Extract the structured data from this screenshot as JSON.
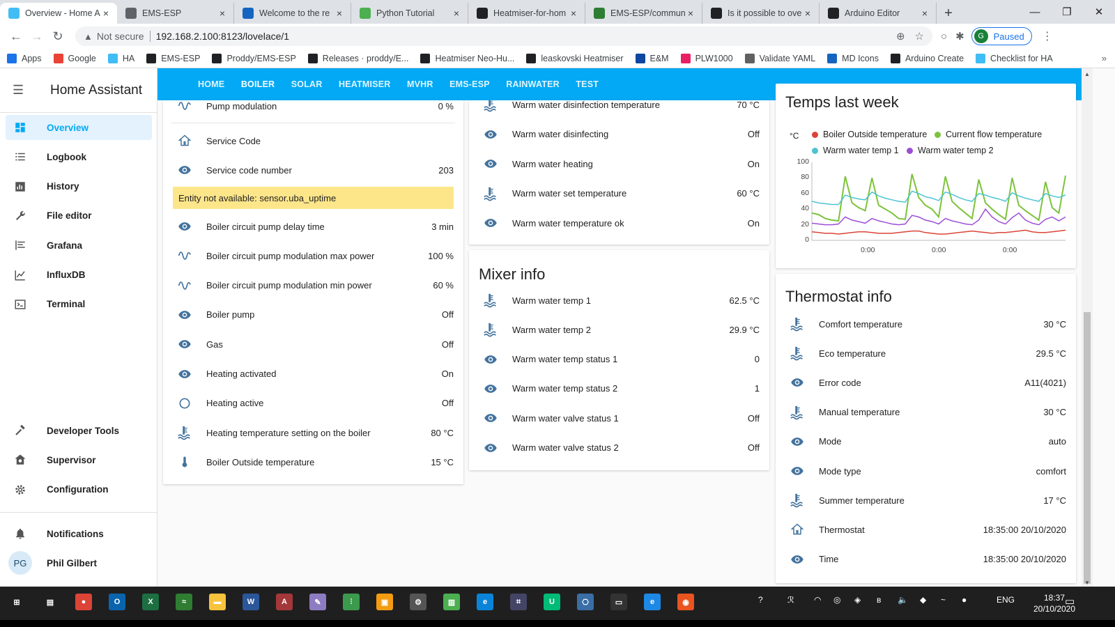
{
  "browser": {
    "tabs": [
      {
        "title": "Overview - Home A",
        "favicon_color": "#41bdf5",
        "active": true
      },
      {
        "title": "EMS-ESP",
        "favicon_color": "#5f6368",
        "active": false
      },
      {
        "title": "Welcome to the re",
        "favicon_color": "#1565c0",
        "active": false
      },
      {
        "title": "Python Tutorial",
        "favicon_color": "#4caf50",
        "active": false
      },
      {
        "title": "Heatmiser-for-hom",
        "favicon_color": "#202124",
        "active": false
      },
      {
        "title": "EMS-ESP/communit",
        "favicon_color": "#2e7d32",
        "active": false
      },
      {
        "title": "Is it possible to ove",
        "favicon_color": "#202124",
        "active": false
      },
      {
        "title": "Arduino Editor",
        "favicon_color": "#202124",
        "active": false
      }
    ],
    "new_tab": "+",
    "close_glyph": "×",
    "window_controls": [
      "—",
      "❐",
      "✕"
    ],
    "security_label": "Not secure",
    "url": "192.168.2.100:8123/lovelace/1",
    "profile_initial": "G",
    "profile_status": "Paused",
    "bookmarks": [
      {
        "label": "Apps",
        "color": "#1a73e8"
      },
      {
        "label": "Google",
        "color": "#ea4335"
      },
      {
        "label": "HA",
        "color": "#41bdf5"
      },
      {
        "label": "EMS-ESP",
        "color": "#202124"
      },
      {
        "label": "Proddy/EMS-ESP",
        "color": "#202124"
      },
      {
        "label": "Releases · proddy/E...",
        "color": "#202124"
      },
      {
        "label": "Heatmiser Neo-Hu...",
        "color": "#202124"
      },
      {
        "label": "leaskovski Heatmiser",
        "color": "#202124"
      },
      {
        "label": "E&M",
        "color": "#0d47a1"
      },
      {
        "label": "PLW1000",
        "color": "#e91e63"
      },
      {
        "label": "Validate YAML",
        "color": "#616161"
      },
      {
        "label": "MD Icons",
        "color": "#1565c0"
      },
      {
        "label": "Arduino Create",
        "color": "#202124"
      },
      {
        "label": "Checklist for HA",
        "color": "#41bdf5"
      }
    ]
  },
  "sidebar": {
    "title": "Home Assistant",
    "items": [
      {
        "label": "Overview",
        "icon": "dashboard-icon",
        "active": true
      },
      {
        "label": "Logbook",
        "icon": "logbook-icon"
      },
      {
        "label": "History",
        "icon": "history-icon"
      },
      {
        "label": "File editor",
        "icon": "wrench-icon"
      },
      {
        "label": "Grafana",
        "icon": "grafana-icon"
      },
      {
        "label": "InfluxDB",
        "icon": "chart-line-icon"
      },
      {
        "label": "Terminal",
        "icon": "terminal-icon"
      }
    ],
    "bottom_items": [
      {
        "label": "Developer Tools",
        "icon": "hammer-icon"
      },
      {
        "label": "Supervisor",
        "icon": "supervisor-icon"
      },
      {
        "label": "Configuration",
        "icon": "cog-icon"
      }
    ],
    "notifications": "Notifications",
    "user": {
      "initials": "PG",
      "name": "Phil Gilbert"
    }
  },
  "header": {
    "tabs": [
      "HOME",
      "BOILER",
      "SOLAR",
      "HEATMISER",
      "MVHR",
      "EMS-ESP",
      "RAINWATER",
      "TEST"
    ],
    "active_tab": "BOILER"
  },
  "boiler_card": {
    "rows_top": [
      {
        "label": "Pump modulation",
        "value": "0 %",
        "icon": "sine-wave-icon"
      },
      {
        "label": "Service Code",
        "value": "",
        "icon": "home-outline-icon"
      },
      {
        "label": "Service code number",
        "value": "203",
        "icon": "eye-icon"
      }
    ],
    "warning": "Entity not available: sensor.uba_uptime",
    "rows": [
      {
        "label": "Boiler circuit pump delay time",
        "value": "3 min",
        "icon": "eye-icon"
      },
      {
        "label": "Boiler circuit pump modulation max power",
        "value": "100 %",
        "icon": "sine-wave-icon"
      },
      {
        "label": "Boiler circuit pump modulation min power",
        "value": "60 %",
        "icon": "sine-wave-icon"
      },
      {
        "label": "Boiler pump",
        "value": "Off",
        "icon": "eye-icon"
      },
      {
        "label": "Gas",
        "value": "Off",
        "icon": "eye-icon"
      },
      {
        "label": "Heating activated",
        "value": "On",
        "icon": "eye-icon"
      },
      {
        "label": "Heating active",
        "value": "Off",
        "icon": "circle-outline-icon"
      },
      {
        "label": "Heating temperature setting on the boiler",
        "value": "80 °C",
        "icon": "water-thermometer-icon"
      },
      {
        "label": "Boiler Outside temperature",
        "value": "15 °C",
        "icon": "thermometer-icon"
      }
    ]
  },
  "warmwater_card": {
    "rows": [
      {
        "label": "Warm water disinfection temperature",
        "value": "70 °C",
        "icon": "water-thermometer-icon"
      },
      {
        "label": "Warm water disinfecting",
        "value": "Off",
        "icon": "eye-icon"
      },
      {
        "label": "Warm water heating",
        "value": "On",
        "icon": "eye-icon"
      },
      {
        "label": "Warm water set temperature",
        "value": "60 °C",
        "icon": "water-thermometer-icon"
      },
      {
        "label": "Warm water temperature ok",
        "value": "On",
        "icon": "eye-icon"
      }
    ]
  },
  "mixer_card": {
    "title": "Mixer info",
    "rows": [
      {
        "label": "Warm water temp 1",
        "value": "62.5 °C",
        "icon": "water-thermometer-icon"
      },
      {
        "label": "Warm water temp 2",
        "value": "29.9 °C",
        "icon": "water-thermometer-icon"
      },
      {
        "label": "Warm water temp status 1",
        "value": "0",
        "icon": "eye-icon"
      },
      {
        "label": "Warm water temp status 2",
        "value": "1",
        "icon": "eye-icon"
      },
      {
        "label": "Warm water valve status 1",
        "value": "Off",
        "icon": "eye-icon"
      },
      {
        "label": "Warm water valve status 2",
        "value": "Off",
        "icon": "eye-icon"
      }
    ]
  },
  "temps_card": {
    "title": "Temps last week",
    "unit": "°C",
    "legend": [
      {
        "name": "Boiler Outside temperature",
        "color": "#db4437"
      },
      {
        "name": "Current flow temperature",
        "color": "#7cc33a"
      },
      {
        "name": "Warm water temp 1",
        "color": "#4dc4d2"
      },
      {
        "name": "Warm water temp 2",
        "color": "#9c4fd6"
      }
    ]
  },
  "chart_data": {
    "type": "line",
    "title": "Temps last week",
    "ylabel": "°C",
    "xlabel": "",
    "ylim": [
      0,
      100
    ],
    "yticks": [
      "100",
      "80",
      "60",
      "40",
      "20",
      "0"
    ],
    "xticks": [
      "0:00",
      "0:00",
      "0:00"
    ],
    "grid": false,
    "legend_position": "top",
    "series": [
      {
        "name": "Boiler Outside temperature",
        "color": "#db4437",
        "values": [
          11,
          10,
          9,
          9,
          8,
          9,
          10,
          11,
          11,
          10,
          9,
          9,
          9,
          10,
          11,
          12,
          12,
          10,
          9,
          8,
          8,
          9,
          10,
          11,
          12,
          11,
          10,
          9,
          10,
          10,
          11,
          12,
          13,
          11,
          10,
          10,
          11,
          12,
          13
        ]
      },
      {
        "name": "Current flow temperature",
        "color": "#7cc33a",
        "values": [
          35,
          33,
          28,
          26,
          25,
          82,
          48,
          42,
          38,
          80,
          45,
          40,
          35,
          28,
          27,
          85,
          55,
          45,
          40,
          30,
          82,
          50,
          42,
          35,
          28,
          78,
          48,
          40,
          33,
          27,
          80,
          45,
          38,
          32,
          26,
          75,
          42,
          35,
          83
        ]
      },
      {
        "name": "Warm water temp 1",
        "color": "#4dc4d2",
        "values": [
          50,
          48,
          47,
          46,
          46,
          58,
          55,
          53,
          52,
          62,
          57,
          54,
          52,
          50,
          49,
          63,
          60,
          56,
          54,
          51,
          62,
          59,
          55,
          52,
          50,
          60,
          58,
          55,
          53,
          50,
          61,
          57,
          54,
          52,
          50,
          60,
          57,
          55,
          58
        ]
      },
      {
        "name": "Warm water temp 2",
        "color": "#9c4fd6",
        "values": [
          22,
          21,
          20,
          20,
          21,
          30,
          26,
          24,
          22,
          28,
          25,
          23,
          21,
          20,
          21,
          32,
          30,
          26,
          24,
          21,
          28,
          25,
          23,
          21,
          20,
          26,
          40,
          30,
          24,
          21,
          29,
          35,
          26,
          22,
          20,
          27,
          30,
          25,
          30
        ]
      }
    ]
  },
  "thermostat_card": {
    "title": "Thermostat info",
    "rows": [
      {
        "label": "Comfort temperature",
        "value": "30 °C",
        "icon": "water-thermometer-icon"
      },
      {
        "label": "Eco temperature",
        "value": "29.5 °C",
        "icon": "water-thermometer-icon"
      },
      {
        "label": "Error code",
        "value": "A11(4021)",
        "icon": "eye-icon"
      },
      {
        "label": "Manual temperature",
        "value": "30 °C",
        "icon": "water-thermometer-icon"
      },
      {
        "label": "Mode",
        "value": "auto",
        "icon": "eye-icon"
      },
      {
        "label": "Mode type",
        "value": "comfort",
        "icon": "eye-icon"
      },
      {
        "label": "Summer temperature",
        "value": "17 °C",
        "icon": "water-thermometer-icon"
      },
      {
        "label": "Thermostat",
        "value": "18:35:00 20/10/2020",
        "icon": "home-outline-icon"
      },
      {
        "label": "Time",
        "value": "18:35:00 20/10/2020",
        "icon": "eye-icon"
      }
    ]
  },
  "taskbar": {
    "language": "ENG",
    "time": "18:37",
    "date": "20/10/2020"
  },
  "colors": {
    "ha_primary": "#03a9f4",
    "icon_blue": "#44739e",
    "warning_bg": "#fde68a"
  }
}
